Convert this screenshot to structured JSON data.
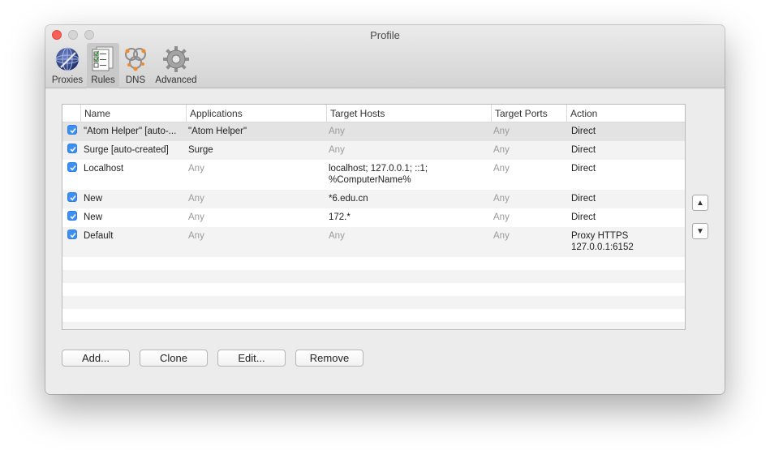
{
  "window": {
    "title": "Profile"
  },
  "toolbar": {
    "items": [
      {
        "label": "Proxies",
        "icon": "globe-icon"
      },
      {
        "label": "Rules",
        "icon": "checklist-icon",
        "active": true
      },
      {
        "label": "DNS",
        "icon": "dns-icon"
      },
      {
        "label": "Advanced",
        "icon": "gear-icon"
      }
    ]
  },
  "table": {
    "columns": [
      "Name",
      "Applications",
      "Target Hosts",
      "Target Ports",
      "Action"
    ],
    "rows": [
      {
        "enabled": true,
        "name": "\"Atom Helper\" [auto-...",
        "applications": "\"Atom Helper\"",
        "hosts": "Any",
        "ports": "Any",
        "action": "Direct"
      },
      {
        "enabled": true,
        "name": "Surge [auto-created]",
        "applications": "Surge",
        "hosts": "Any",
        "ports": "Any",
        "action": "Direct"
      },
      {
        "enabled": true,
        "name": "Localhost",
        "applications": "Any",
        "hosts": "localhost; 127.0.0.1; ::1;\n%ComputerName%",
        "ports": "Any",
        "action": "Direct"
      },
      {
        "enabled": true,
        "name": "New",
        "applications": "Any",
        "hosts": "*6.edu.cn",
        "ports": "Any",
        "action": "Direct"
      },
      {
        "enabled": true,
        "name": "New",
        "applications": "Any",
        "hosts": "172.*",
        "ports": "Any",
        "action": "Direct"
      },
      {
        "enabled": true,
        "name": "Default",
        "applications": "Any",
        "hosts": "Any",
        "ports": "Any",
        "action": "Proxy HTTPS\n127.0.0.1:6152"
      }
    ]
  },
  "side_buttons": {
    "up": "▲",
    "down": "▼"
  },
  "buttons": {
    "add": "Add...",
    "clone": "Clone",
    "edit": "Edit...",
    "remove": "Remove"
  },
  "colors": {
    "checkbox": "#3b8ff6",
    "close": "#fc5f57",
    "selected_row": "#e3e3e3"
  }
}
